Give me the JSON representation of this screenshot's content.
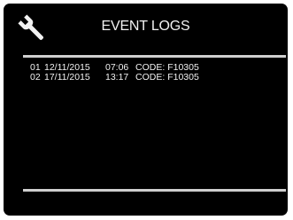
{
  "header": {
    "title": "EVENT LOGS",
    "settings_icon": "wrench-icon"
  },
  "event_logs": {
    "code_label": "CODE:",
    "entries": [
      {
        "index": "01",
        "date": "12/11/2015",
        "time": "07:06",
        "code": "F10305"
      },
      {
        "index": "02",
        "date": "17/11/2015",
        "time": "13:17",
        "code": "F10305"
      }
    ]
  },
  "colors": {
    "background": "#000000",
    "text": "#f2f2f2",
    "divider": "#cfcfcf"
  }
}
